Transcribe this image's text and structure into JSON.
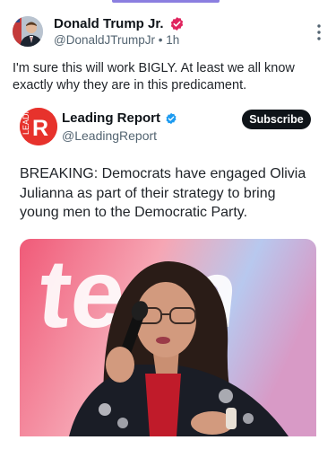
{
  "post": {
    "author_name": "Donald Trump Jr.",
    "handle": "@DonaldJTrumpJr",
    "separator": "•",
    "time": "1h",
    "text": "I'm sure this will work BIGLY. At least we all know exactly why they are in this predicament."
  },
  "quoted": {
    "author_name": "Leading Report",
    "handle": "@LeadingReport",
    "logo_letter": "R",
    "logo_side_text": "LEADING",
    "subscribe_label": "Subscribe",
    "text": "BREAKING: Democrats have engaged Olivia Julianna as part of their strategy to bring young men to the Democratic Party.",
    "image_backdrop_text": "teen"
  },
  "colors": {
    "accent_tab": "#8b7fe0",
    "verified_pink": "#e0245e",
    "verified_blue": "#1d9bf0",
    "logo_red": "#e7322c",
    "subscribe_bg": "#0f1419"
  },
  "icons": {
    "more": "more-vertical-icon",
    "verified_author": "verified-badge-icon",
    "verified_quoted": "verified-badge-icon"
  }
}
